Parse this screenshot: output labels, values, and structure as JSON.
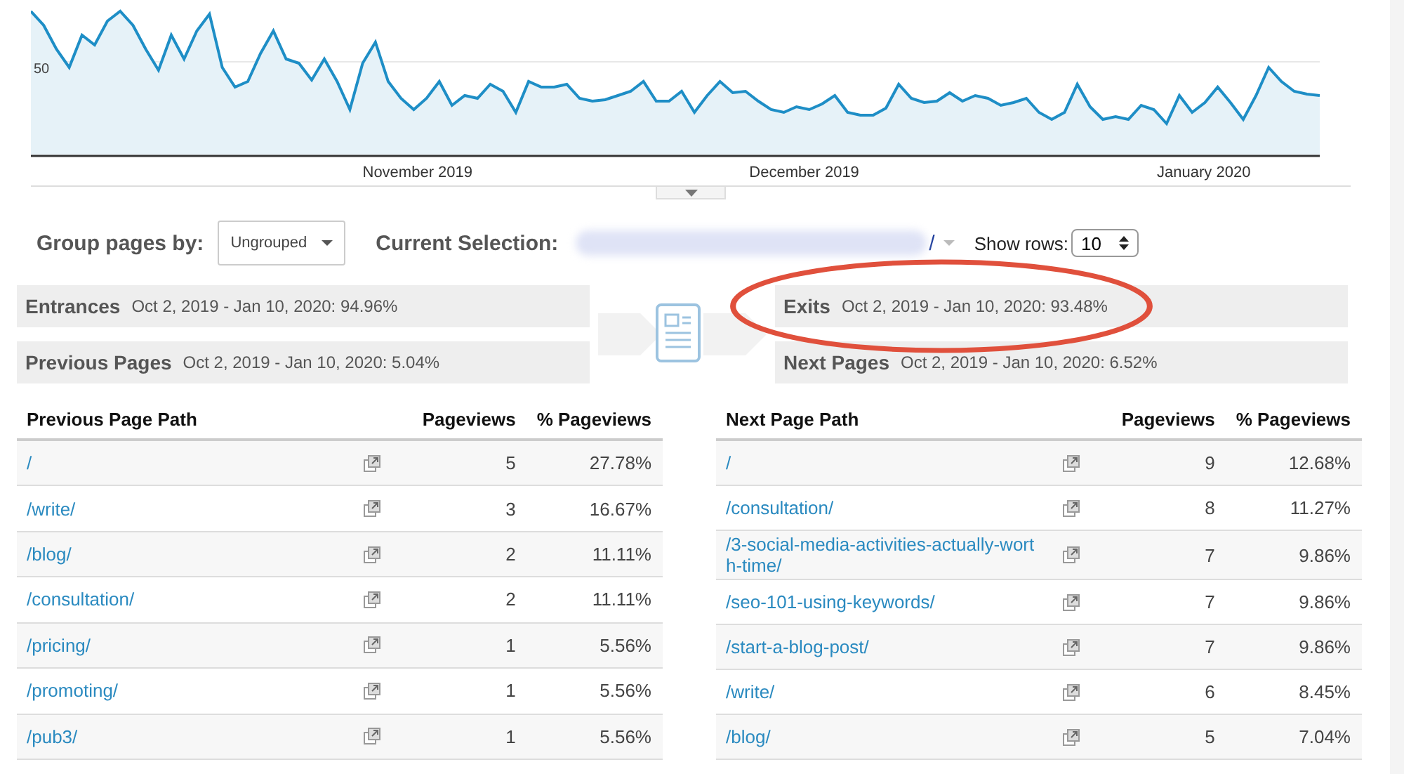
{
  "chart": {
    "y_tick": "50",
    "x_labels": [
      "November 2019",
      "December 2019",
      "January 2020"
    ]
  },
  "controls": {
    "group_label": "Group pages by:",
    "group_value": "Ungrouped",
    "selection_label": "Current Selection:",
    "selection_path": "/",
    "rows_label": "Show rows:",
    "rows_value": "10"
  },
  "flow": {
    "left": [
      {
        "title": "Entrances",
        "detail": "Oct 2, 2019 - Jan 10, 2020: 94.96%",
        "highlighted": false
      },
      {
        "title": "Previous Pages",
        "detail": "Oct 2, 2019 - Jan 10, 2020: 5.04%",
        "highlighted": false
      }
    ],
    "right": [
      {
        "title": "Exits",
        "detail": "Oct 2, 2019 - Jan 10, 2020: 93.48%",
        "highlighted": true
      },
      {
        "title": "Next Pages",
        "detail": "Oct 2, 2019 - Jan 10, 2020: 6.52%",
        "highlighted": false
      }
    ]
  },
  "tables": [
    {
      "columns": [
        "Previous Page Path",
        "Pageviews",
        "% Pageviews"
      ],
      "rows": [
        {
          "path": "/",
          "pageviews": "5",
          "percent": "27.78%"
        },
        {
          "path": "/write/",
          "pageviews": "3",
          "percent": "16.67%"
        },
        {
          "path": "/blog/",
          "pageviews": "2",
          "percent": "11.11%"
        },
        {
          "path": "/consultation/",
          "pageviews": "2",
          "percent": "11.11%"
        },
        {
          "path": "/pricing/",
          "pageviews": "1",
          "percent": "5.56%"
        },
        {
          "path": "/promoting/",
          "pageviews": "1",
          "percent": "5.56%"
        },
        {
          "path": "/pub3/",
          "pageviews": "1",
          "percent": "5.56%"
        }
      ]
    },
    {
      "columns": [
        "Next Page Path",
        "Pageviews",
        "% Pageviews"
      ],
      "rows": [
        {
          "path": "/",
          "pageviews": "9",
          "percent": "12.68%"
        },
        {
          "path": "/consultation/",
          "pageviews": "8",
          "percent": "11.27%"
        },
        {
          "path": "/3-social-media-activities-actually-worth-time/",
          "pageviews": "7",
          "percent": "9.86%"
        },
        {
          "path": "/seo-101-using-keywords/",
          "pageviews": "7",
          "percent": "9.86%"
        },
        {
          "path": "/start-a-blog-post/",
          "pageviews": "7",
          "percent": "9.86%"
        },
        {
          "path": "/write/",
          "pageviews": "6",
          "percent": "8.45%"
        },
        {
          "path": "/blog/",
          "pageviews": "5",
          "percent": "7.04%"
        }
      ]
    }
  ]
}
